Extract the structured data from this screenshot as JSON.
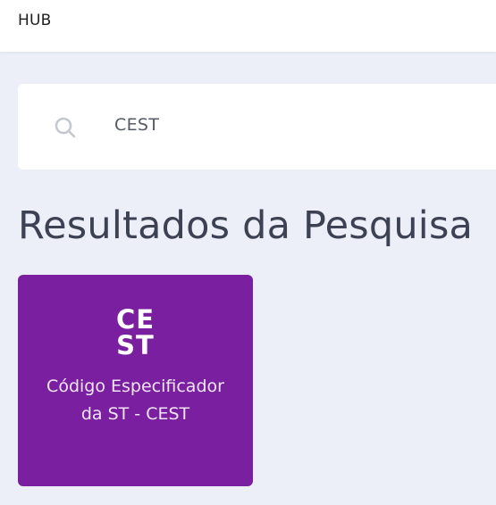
{
  "header": {
    "title": "HUB"
  },
  "search": {
    "icon": "search-icon",
    "value": "CEST"
  },
  "results": {
    "title": "Resultados da Pesquisa",
    "cards": [
      {
        "logo_line1": "CE",
        "logo_line2": "ST",
        "label": "Código Especificador da ST - CEST",
        "color": "#7a1f9f"
      }
    ]
  },
  "colors": {
    "background": "#eceff7",
    "card_accent": "#7a1f9f",
    "title_text": "#3c4254"
  }
}
